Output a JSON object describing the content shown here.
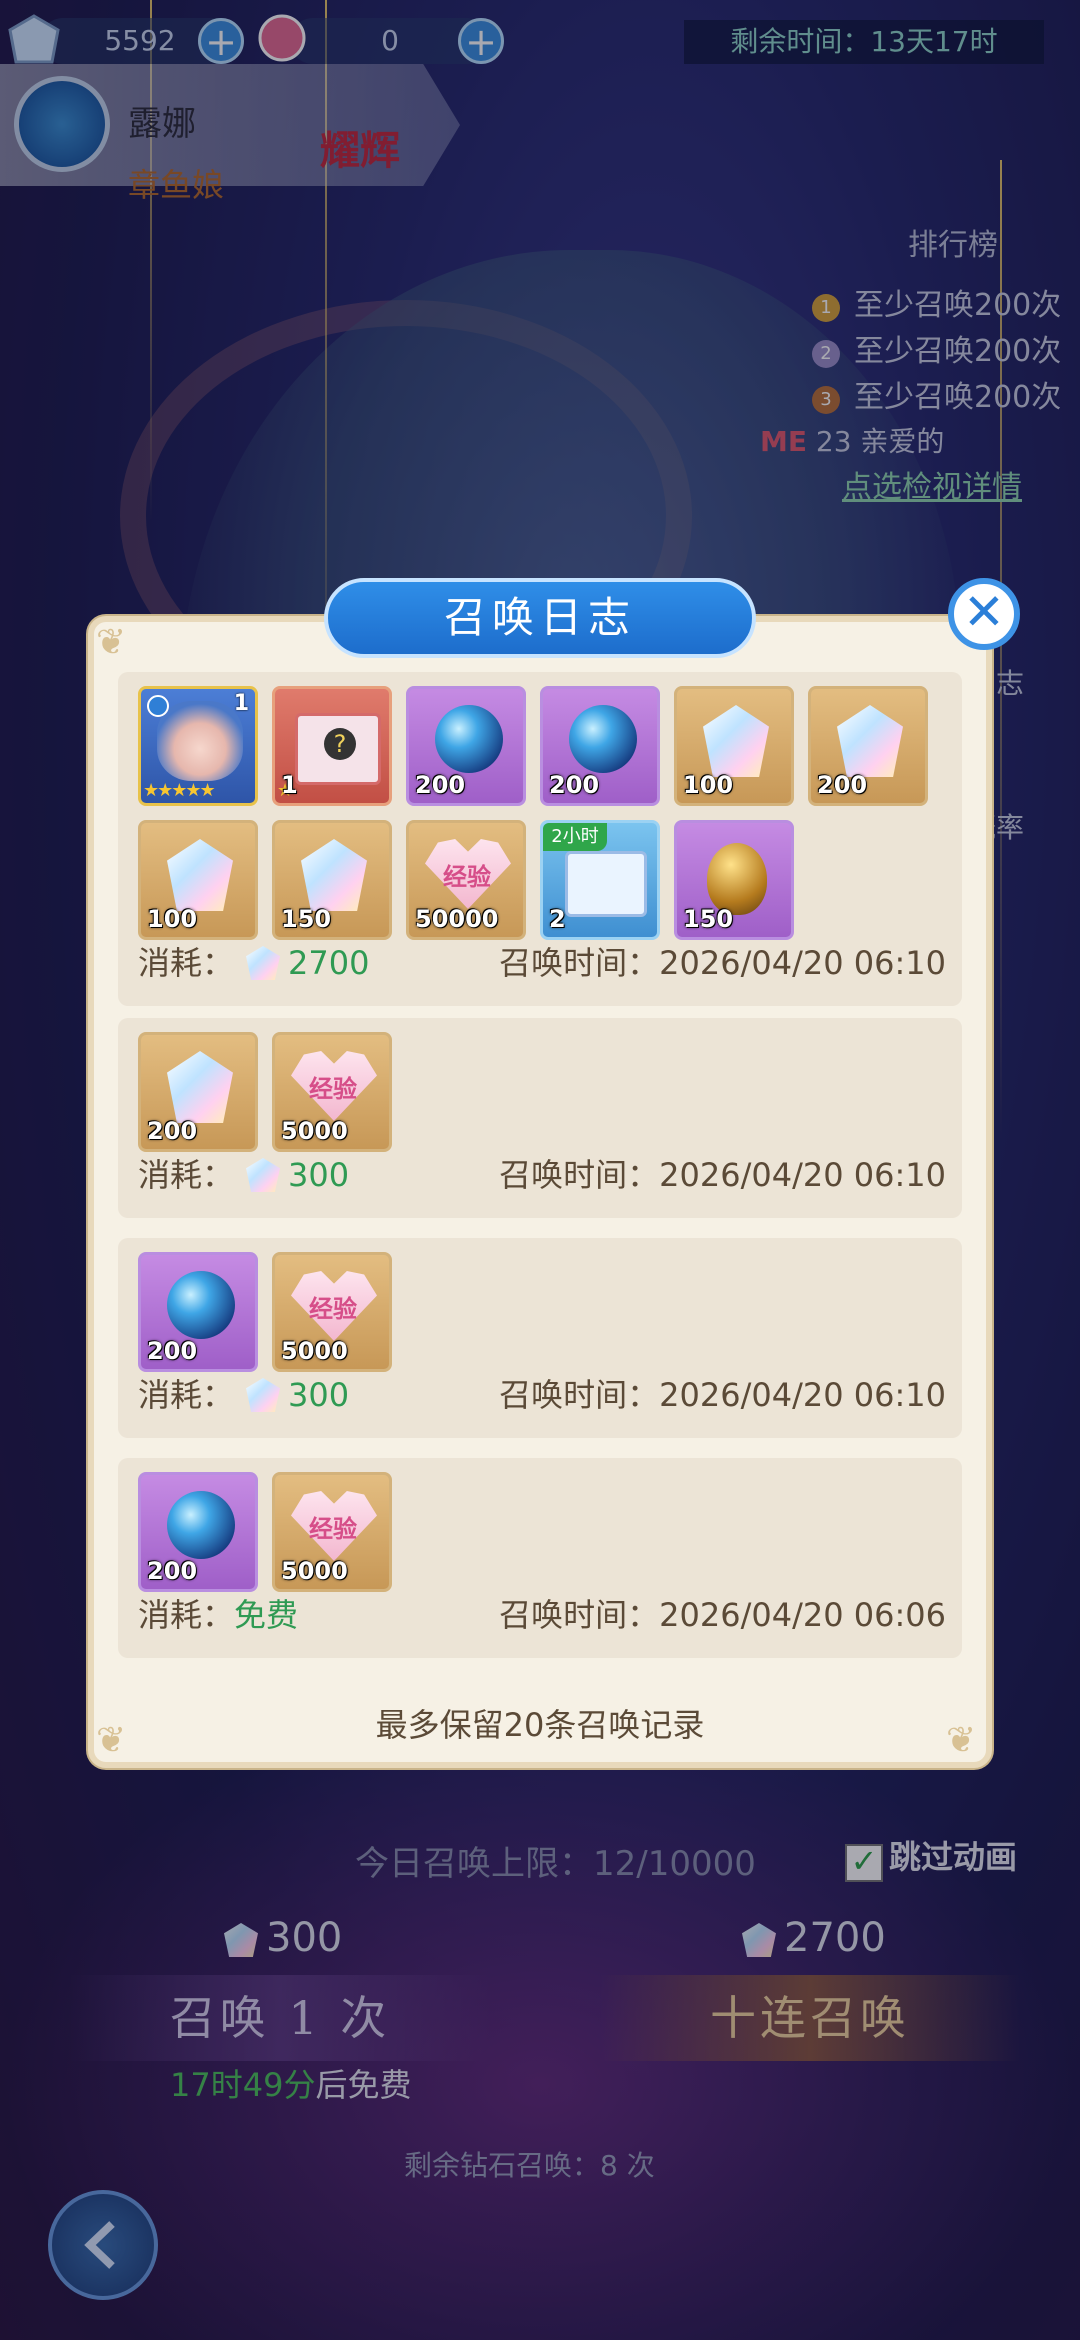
{
  "topbar": {
    "diamonds": "5592",
    "tickets": "0",
    "timer": "剩余时间：13天17时"
  },
  "hero": {
    "name": "露娜",
    "subtitle": "章鱼娘",
    "badge": "耀辉"
  },
  "ranking": {
    "title": "排行榜",
    "rows": [
      "至少召唤200次",
      "至少召唤200次",
      "至少召唤200次"
    ],
    "me_label": "ME",
    "me_text": "23 亲爱的",
    "detail_link": "点选检视详情"
  },
  "side": {
    "log_btn": "日志",
    "rate_btn": "概率"
  },
  "modal": {
    "title": "召唤日志",
    "close": "✕",
    "cost_label": "消耗：",
    "time_label": "召唤时间：",
    "footer": "最多保留20条召唤记录",
    "entries": [
      {
        "items": [
          {
            "kind": "hero",
            "qty": "1"
          },
          {
            "kind": "gift",
            "qty": "1"
          },
          {
            "kind": "orb",
            "qty": "200"
          },
          {
            "kind": "orb",
            "qty": "200"
          },
          {
            "kind": "crystal",
            "qty": "100"
          },
          {
            "kind": "crystal",
            "qty": "200"
          },
          {
            "kind": "crystal",
            "qty": "100"
          },
          {
            "kind": "crystal",
            "qty": "150"
          },
          {
            "kind": "exp",
            "qty": "50000"
          },
          {
            "kind": "chest",
            "qty": "2",
            "tag": "2小时"
          },
          {
            "kind": "egg",
            "qty": "150"
          }
        ],
        "cost": "2700",
        "time": "2026/04/20 06:10"
      },
      {
        "items": [
          {
            "kind": "crystal",
            "qty": "200"
          },
          {
            "kind": "exp",
            "qty": "5000"
          }
        ],
        "cost": "300",
        "time": "2026/04/20 06:10"
      },
      {
        "items": [
          {
            "kind": "orb",
            "qty": "200"
          },
          {
            "kind": "exp",
            "qty": "5000"
          }
        ],
        "cost": "300",
        "time": "2026/04/20 06:10"
      },
      {
        "items": [
          {
            "kind": "orb",
            "qty": "200"
          },
          {
            "kind": "exp",
            "qty": "5000"
          }
        ],
        "cost": "免费",
        "time": "2026/04/20 06:06"
      }
    ],
    "exp_text": "经验"
  },
  "summon": {
    "daily_limit": "今日召唤上限：12/10000",
    "skip_anim": "跳过动画",
    "cost_single": "300",
    "cost_ten": "2700",
    "btn_single": "召唤 1 次",
    "btn_ten": "十连召唤",
    "free_time": "17时49分",
    "free_suffix": "后免费",
    "remain": "剩余钻石召唤：8 次"
  },
  "colors": {
    "accent_blue": "#2f8ee8",
    "cost_green": "#2f9a53",
    "modal_bg": "#f6f1e5"
  }
}
